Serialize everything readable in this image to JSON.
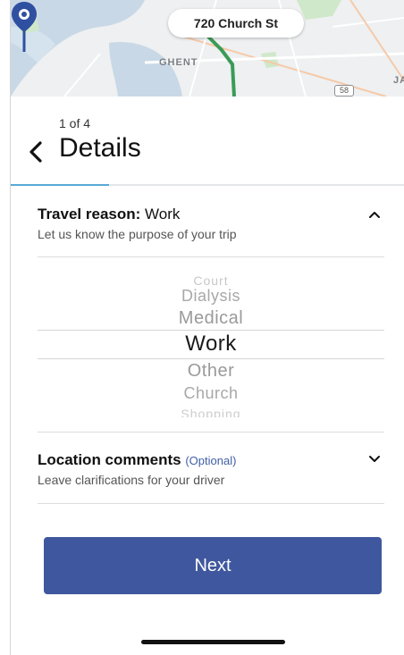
{
  "map": {
    "address": "720 Church St",
    "place_label": "GHENT",
    "place_label_2": "JA",
    "route_shield": "58",
    "colors": {
      "water": "#c9d8e6",
      "land": "#eef0f1",
      "park": "#cfe8c9",
      "route": "#3a9b57",
      "pin": "#2f4fa0"
    }
  },
  "header": {
    "step": "1 of 4",
    "title": "Details",
    "progress": 0.25,
    "accent": "#5aa9d6"
  },
  "travel_reason": {
    "label": "Travel reason:",
    "value": "Work",
    "subtitle": "Let us know the purpose of your trip",
    "options": [
      "Court",
      "Dialysis",
      "Medical",
      "Work",
      "Other",
      "Church",
      "Shopping"
    ],
    "selected": "Work"
  },
  "location_comments": {
    "label": "Location comments",
    "optional": "(Optional)",
    "subtitle": "Leave clarifications for your driver"
  },
  "actions": {
    "next_label": "Next",
    "button_color": "#3f579e"
  }
}
